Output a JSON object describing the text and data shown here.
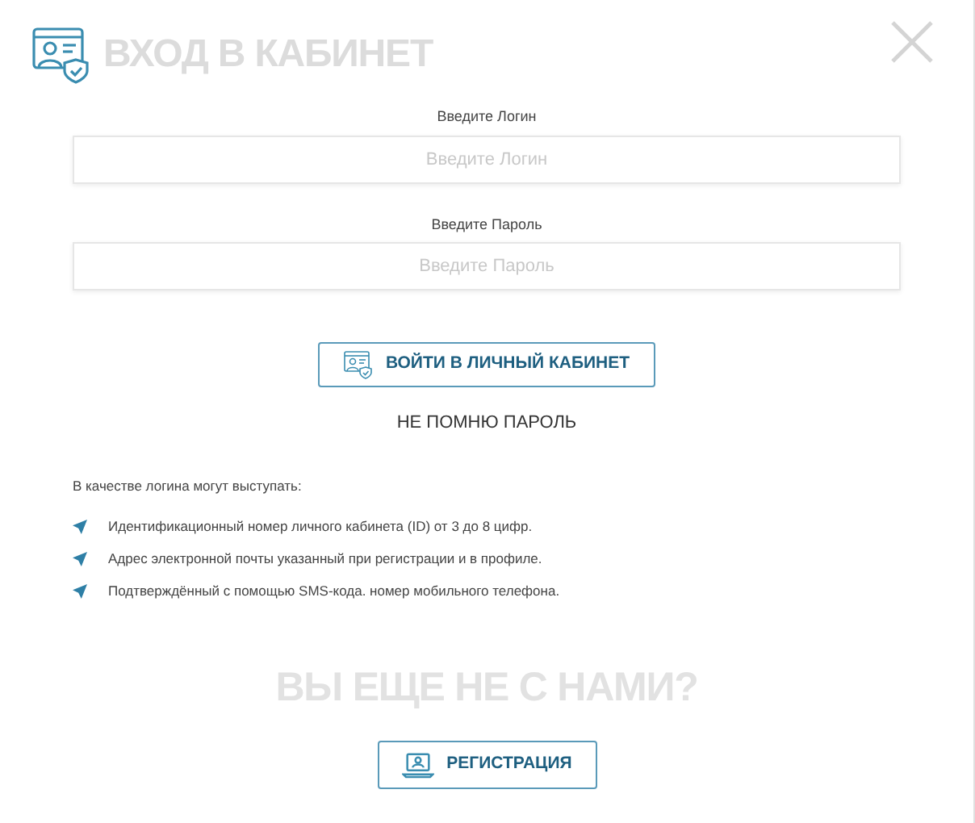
{
  "title": "ВХОД В КАБИНЕТ",
  "fields": [
    {
      "label": "Введите Логин",
      "placeholder": "Введите Логин"
    },
    {
      "label": "Введите Пароль",
      "placeholder": "Введите Пароль"
    }
  ],
  "login_button": "ВОЙТИ В ЛИЧНЫЙ КАБИНЕТ",
  "forgot_link": "НЕ ПОМНЮ ПАРОЛЬ",
  "info_intro": "В качестве логина могут выступать:",
  "info_items": [
    "Идентификационный номер личного кабинета (ID) от 3 до 8 цифр.",
    "Адрес электронной почты указанный при регистрации и в профиле.",
    "Подтверждённый с помощью SMS-кода. номер мобильного телефона."
  ],
  "signup_heading": "ВЫ ЕЩЕ НЕ С НАМИ?",
  "signup_button": "РЕГИСТРАЦИЯ"
}
